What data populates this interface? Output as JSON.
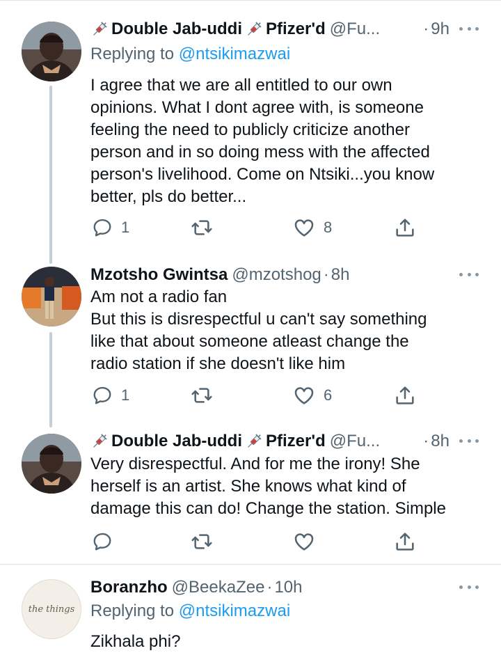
{
  "tweets": [
    {
      "name_part1": "Double Jab-uddi",
      "name_part2": "Pfizer'd",
      "handle": "@Fu...",
      "time": "9h",
      "replying_prefix": "Replying to",
      "replying_mention": "@ntsikimazwai",
      "text": "I agree that we are all entitled to our own\nopinions. What I dont agree with, is someone\nfeeling the need to publicly criticize another\nperson and in so doing mess with the affected\nperson's livelihood. Come on Ntsiki...you know\nbetter, pls do better...",
      "reply_count": "1",
      "like_count": "8"
    },
    {
      "name": "Mzotsho Gwintsa",
      "handle": "@mzotshog",
      "time": "8h",
      "text": "Am not a radio fan\nBut this is disrespectful u can't say something\nlike that about someone atleast change the\nradio station if she doesn't like him",
      "reply_count": "1",
      "like_count": "6"
    },
    {
      "name_part1": "Double Jab-uddi",
      "name_part2": "Pfizer'd",
      "handle": "@Fu...",
      "time": "8h",
      "text": "Very disrespectful. And for me the irony! She\nherself is an artist. She knows what kind of\ndamage this can do! Change the station. Simple"
    },
    {
      "name": "Boranzho",
      "handle": "@BeekaZee",
      "time": "10h",
      "replying_prefix": "Replying to",
      "replying_mention": "@ntsikimazwai",
      "text": "Zikhala phi?",
      "avatar_text": "the things"
    }
  ],
  "separator": "·",
  "colors": {
    "link": "#1d9bf0",
    "secondary_text": "#536471",
    "thread_line": "#c4cfd6",
    "divider": "#dfe3e6"
  },
  "icons": [
    "syringe-icon",
    "reply-icon",
    "retweet-icon",
    "like-icon",
    "share-icon",
    "more-icon"
  ]
}
